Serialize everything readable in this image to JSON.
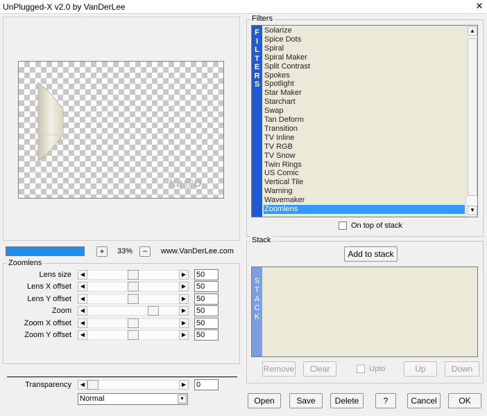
{
  "window": {
    "title": "UnPlugged-X v2.0 by VanDerLee",
    "close_glyph": "✕"
  },
  "preview": {
    "zoom_value": "33%",
    "zoom_in_label": "+",
    "zoom_out_label": "−",
    "url": "www.VanDerLee.com",
    "progress": 1.0,
    "watermark": "Ka@D"
  },
  "params": {
    "group_label": "Zoomlens",
    "rows": [
      {
        "label": "Lens size",
        "value": "50",
        "pos": 0.5
      },
      {
        "label": "Lens X offset",
        "value": "50",
        "pos": 0.5
      },
      {
        "label": "Lens Y offset",
        "value": "50",
        "pos": 0.5
      },
      {
        "label": "Zoom",
        "value": "50",
        "pos": 0.75
      },
      {
        "label": "Zoom X offset",
        "value": "50",
        "pos": 0.5
      },
      {
        "label": "Zoom Y offset",
        "value": "50",
        "pos": 0.5
      }
    ],
    "transparency": {
      "label": "Transparency",
      "value": "0",
      "pos": 0.0
    },
    "blend_mode": "Normal"
  },
  "filters": {
    "group_label": "Filters",
    "side_label": "FILTERS",
    "items": [
      "Solarize",
      "Spice Dots",
      "Spiral",
      "Spiral Maker",
      "Split Contrast",
      "Spokes",
      "Spotlight",
      "Star Maker",
      "Starchart",
      "Swap",
      "Tan Deform",
      "Transition",
      "TV Inline",
      "TV RGB",
      "TV Snow",
      "Twin Rings",
      "US Comic",
      "Vertical Tile",
      "Warning",
      "Wavemaker",
      "Zoomlens"
    ],
    "selected_index": 20,
    "on_top_label": "On top of stack"
  },
  "stack": {
    "group_label": "Stack",
    "side_label": "STACK",
    "add_label": "Add to stack",
    "remove_label": "Remove",
    "clear_label": "Clear",
    "upto_label": "Upto",
    "up_label": "Up",
    "down_label": "Down"
  },
  "buttons": {
    "open": "Open",
    "save": "Save",
    "delete": "Delete",
    "help": "?",
    "cancel": "Cancel",
    "ok": "OK"
  },
  "icons": {
    "scroll_left": "◀",
    "scroll_right": "▶",
    "scroll_up": "▲",
    "scroll_down": "▼",
    "dropdown": "▼"
  }
}
